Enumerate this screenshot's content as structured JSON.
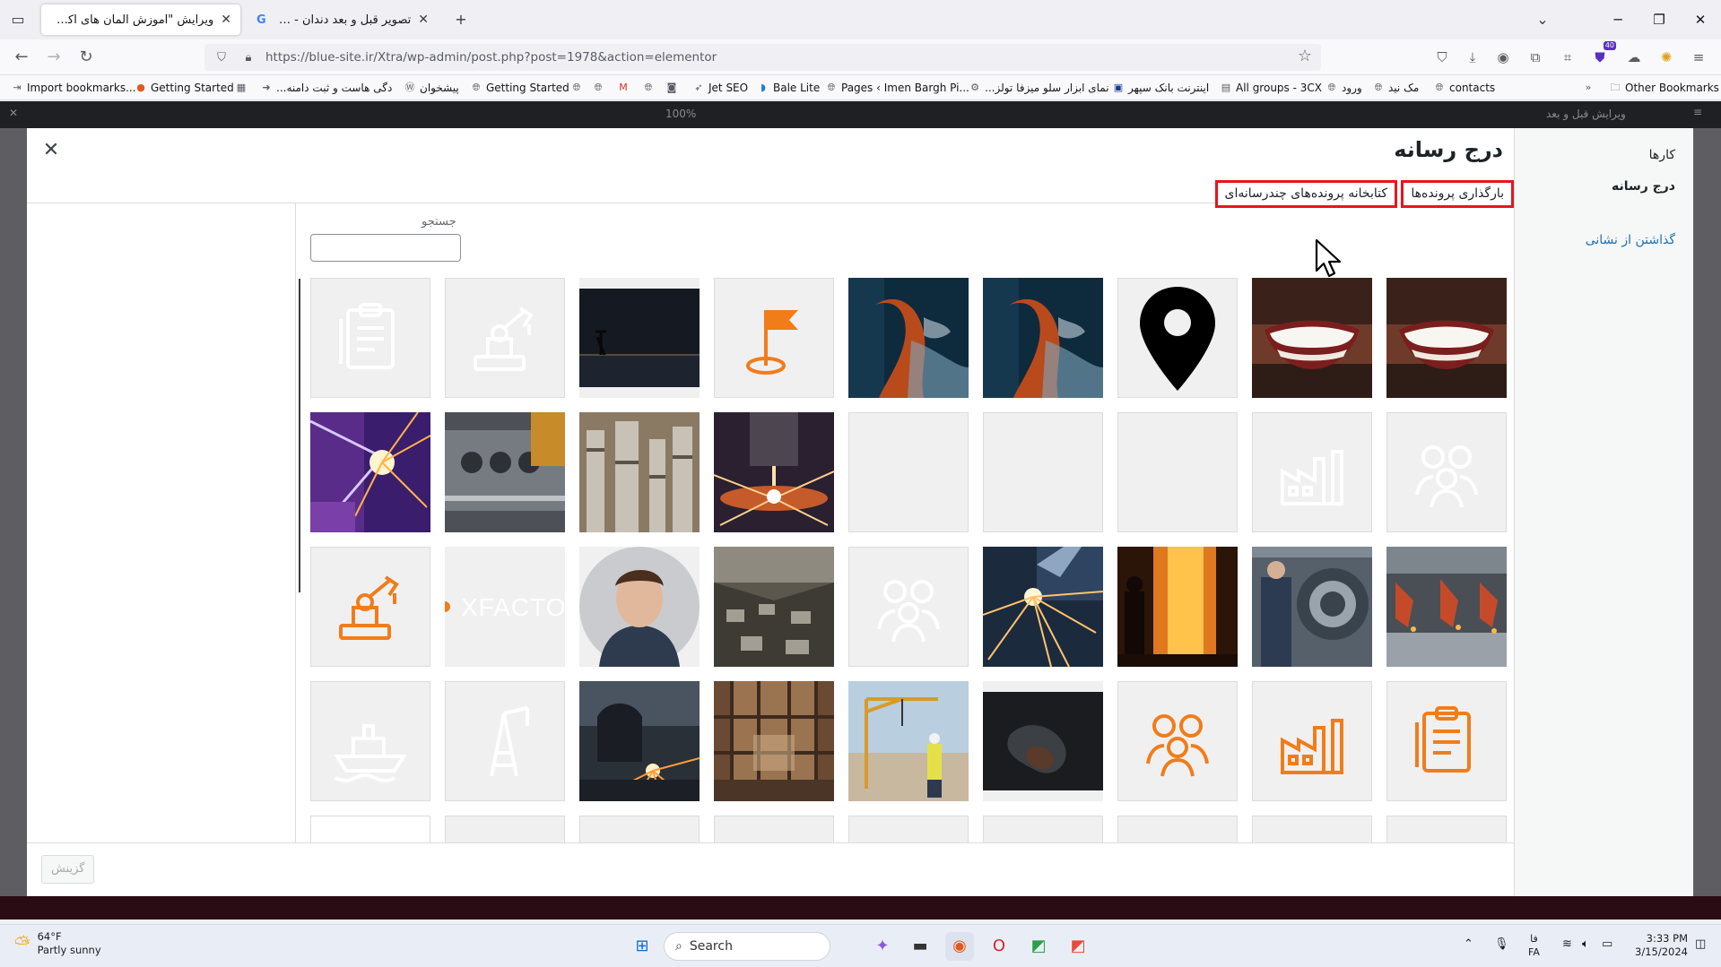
{
  "browser": {
    "tabs": [
      {
        "title": "ویرایش \"آموزش المان های اکسترا – ه",
        "active": true
      },
      {
        "title": "تصویر قبل و بعد دندان - Search",
        "active": false
      }
    ],
    "url": "https://blue-site.ir/Xtra/wp-admin/post.php?post=1978&action=elementor",
    "bookmarks": [
      "Import bookmarks...",
      "Getting Started",
      "...دگی هاست و ثبت دامنه",
      "پیشخوان",
      "Getting Started",
      "Jet SEO",
      "Bale Lite",
      "Pages ‹ Imen Bargh Pi...",
      "...نمای ابزار سلو میزفا تولز",
      "اینترنت بانک سپهر",
      "All groups - 3CX",
      "ورود",
      "مک نید",
      "contacts"
    ],
    "other_bookmarks": "Other Bookmarks",
    "extension_badge": "40"
  },
  "editor": {
    "top_right_title": "ویرایش قبل و بعد",
    "zoom": "100%"
  },
  "modal": {
    "title": "درج رسانه",
    "menu": {
      "actions": "کارها",
      "insert_media": "درج رسانه",
      "insert_from_url": "گذاشتن از نشانی"
    },
    "tabs": {
      "upload": "بارگذاری پرونده‌ها",
      "library": "کتابخانه پرونده‌های چندرسانه‌ای"
    },
    "search_label": "جستجو",
    "search_value": "",
    "select_button": "گزینش",
    "watermark_text": "XFACTO",
    "grid": [
      [
        "form-icon-faded",
        "robot-icon-faded",
        "photo-dusk",
        "flag-icon-orange",
        "photo-worker-fire",
        "photo-worker-fire",
        "map-pin-icon",
        "photo-smile",
        "photo-smile"
      ],
      [
        "photo-welding-purple",
        "photo-engine",
        "photo-refinery",
        "photo-laser",
        "blank",
        "blank",
        "blank",
        "factory-icon-faded",
        "team-icon-faded"
      ],
      [
        "robot-icon-orange",
        "logo-xfacto",
        "photo-portrait",
        "photo-factory-floor",
        "team-icon-faded",
        "photo-sparks",
        "photo-foundry",
        "photo-gears",
        "photo-assembly"
      ],
      [
        "ship-icon-faded",
        "rig-icon-faded",
        "photo-welder",
        "photo-workshop",
        "photo-crane",
        "photo-dark-smoke",
        "team-icon-orange",
        "factory-icon-orange",
        "form-icon-orange"
      ],
      [
        "blank-white",
        "blank",
        "blank",
        "blank",
        "blank",
        "blank",
        "blank",
        "blank",
        "blank"
      ]
    ]
  },
  "taskbar": {
    "weather_temp": "64°F",
    "weather_desc": "Partly sunny",
    "search_placeholder": "Search",
    "lang_top": "فا",
    "lang_bottom": "FA",
    "time": "3:33 PM",
    "date": "3/15/2024"
  },
  "colors": {
    "accent_orange": "#f07d1a",
    "highlight_red": "#e8141f",
    "wp_link_blue": "#2271b1"
  }
}
